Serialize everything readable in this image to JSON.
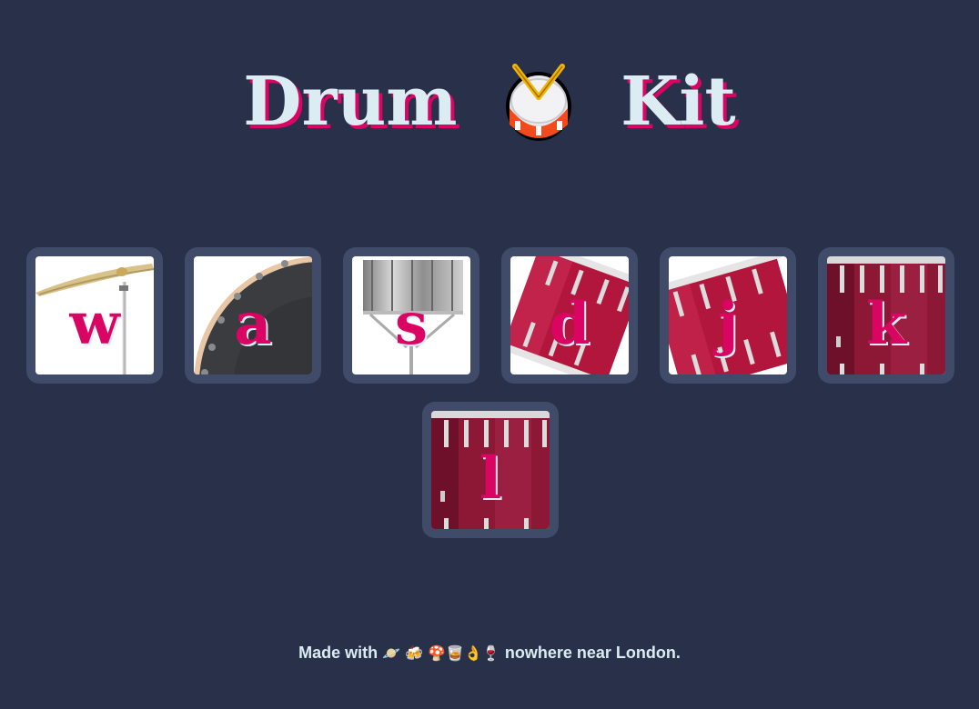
{
  "header": {
    "title_left": "Drum",
    "title_right": "Kit",
    "emoji_icon": "drum-icon"
  },
  "pads": [
    {
      "key": "w",
      "instrument_icon": "cymbal-icon"
    },
    {
      "key": "a",
      "instrument_icon": "bass-drum-icon"
    },
    {
      "key": "s",
      "instrument_icon": "snare-drum-icon"
    },
    {
      "key": "d",
      "instrument_icon": "tom-drum-icon"
    },
    {
      "key": "j",
      "instrument_icon": "tom-drum-icon"
    },
    {
      "key": "k",
      "instrument_icon": "floor-tom-icon"
    },
    {
      "key": "l",
      "instrument_icon": "floor-tom-icon"
    }
  ],
  "footer": {
    "text_before": "Made with",
    "emojis": "🪐 🍻 🍄🥃👌🍷",
    "text_after": "nowhere near London."
  },
  "colors": {
    "background": "#283149",
    "pad_frame": "#404b69",
    "accent": "#da0463",
    "text": "#dbedf3"
  }
}
